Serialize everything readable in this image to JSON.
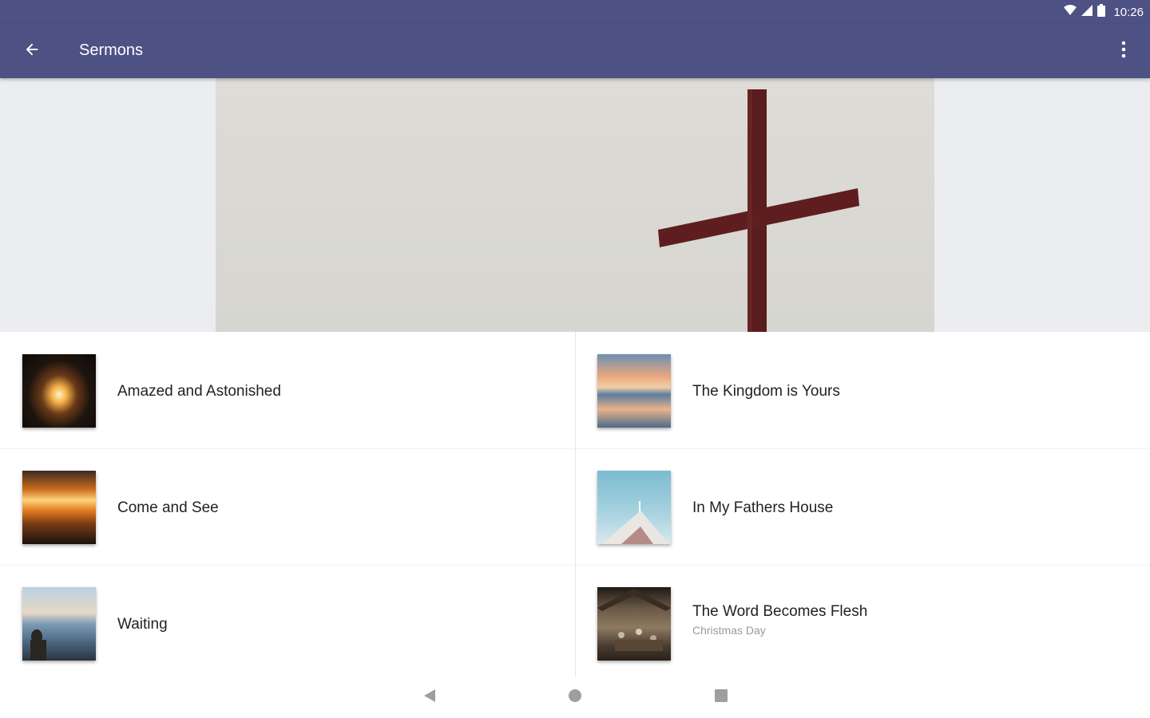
{
  "status_bar": {
    "time": "10:26",
    "icons": [
      "wifi-icon",
      "cell-signal-icon",
      "battery-icon"
    ]
  },
  "app_bar": {
    "title": "Sermons",
    "back_icon": "arrow-back-icon",
    "menu_icon": "more-vert-icon",
    "color": "#4e5183"
  },
  "banner": {
    "image": "red-cross-against-sky"
  },
  "sermons": [
    {
      "title": "Amazed and Astonished",
      "subtitle": "",
      "thumb": "light-in-cave"
    },
    {
      "title": "The Kingdom is Yours",
      "subtitle": "",
      "thumb": "sunset-over-lake"
    },
    {
      "title": "Come and See",
      "subtitle": "",
      "thumb": "orange-sunset"
    },
    {
      "title": "In My Fathers House",
      "subtitle": "",
      "thumb": "church-roof-sky"
    },
    {
      "title": "Waiting",
      "subtitle": "",
      "thumb": "person-by-sea"
    },
    {
      "title": "The Word Becomes Flesh",
      "subtitle": "Christmas Day",
      "thumb": "nativity-scene"
    }
  ],
  "nav_bar": {
    "back_icon": "nav-back-icon",
    "home_icon": "nav-home-icon",
    "recents_icon": "nav-recents-icon"
  }
}
